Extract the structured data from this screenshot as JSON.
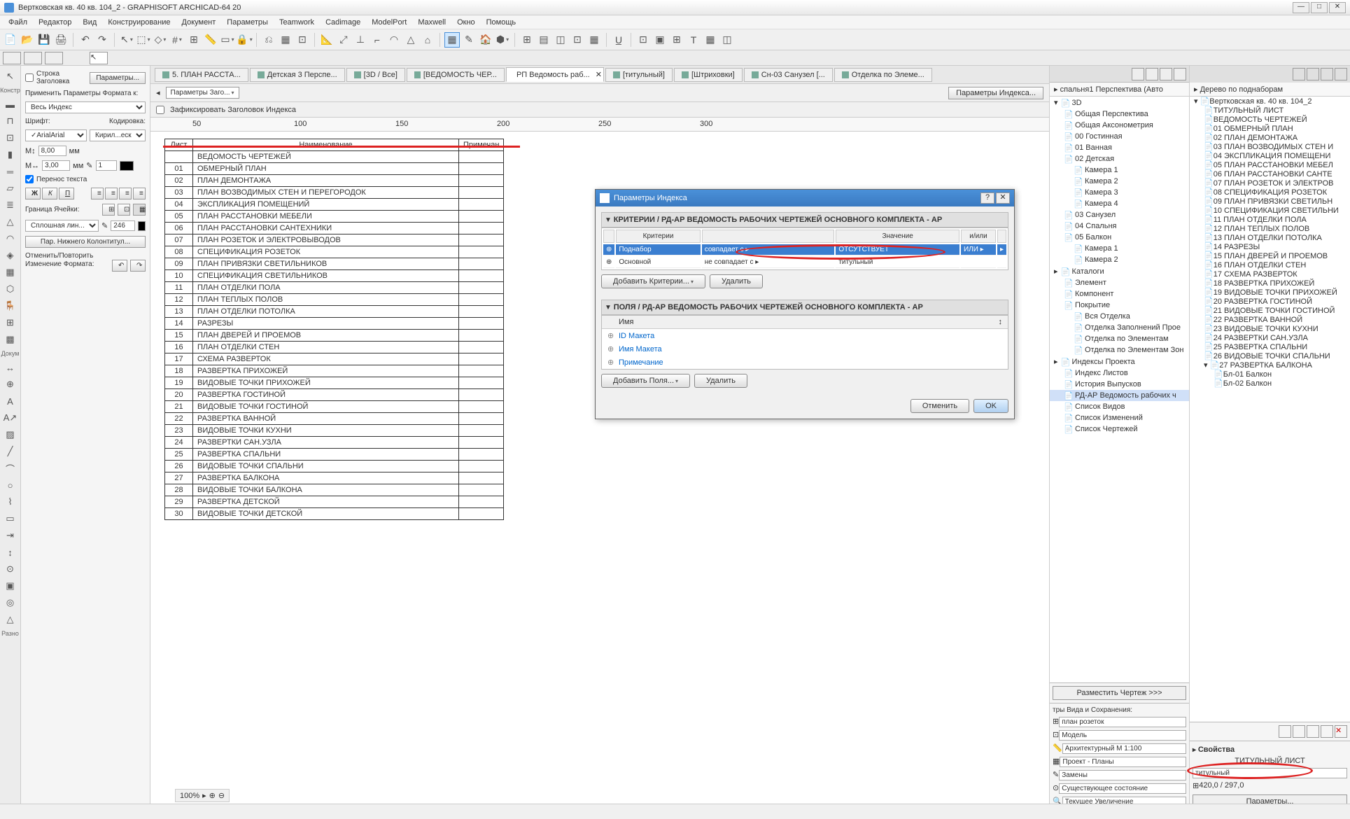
{
  "window": {
    "title": "Вертковская кв. 40 кв. 104_2 - GRAPHISOFT ARCHICAD-64 20"
  },
  "menu": [
    "Файл",
    "Редактор",
    "Вид",
    "Конструирование",
    "Документ",
    "Параметры",
    "Teamwork",
    "Cadimage",
    "ModelPort",
    "Maxwell",
    "Окно",
    "Помощь"
  ],
  "smalltb_arrow": "↖",
  "tabs": [
    {
      "label": "5. ПЛАН РАССТА..."
    },
    {
      "label": "Детская 3 Перспе..."
    },
    {
      "label": "[3D / Все]"
    },
    {
      "label": "[ВЕДОМОСТЬ ЧЕР..."
    },
    {
      "label": "РП Ведомость раб...",
      "active": true,
      "close": true
    },
    {
      "label": "[титульный]"
    },
    {
      "label": "[Штриховки]"
    },
    {
      "label": "Сн-03 Санузел [..."
    },
    {
      "label": "Отделка по Элеме..."
    }
  ],
  "subtool": {
    "header_row": "Строка Заголовка",
    "params_btn": "Параметры...",
    "params_header": "Параметры Заго...",
    "fix_header": "Зафиксировать Заголовок Индекса",
    "index_params": "Параметры Индекса..."
  },
  "format": {
    "apply_label": "Применить Параметры Формата к:",
    "apply_value": "Весь Индекс",
    "font_label": "Шрифт:",
    "encoding_label": "Кодировка:",
    "font_value": "Arial",
    "encoding_value": "Кирил...еский",
    "size1": "8,00",
    "size2": "3,00",
    "unit": "мм",
    "val1": "1",
    "wrap": "Перенос текста",
    "border_label": "Граница Ячейки:",
    "line_style": "Сплошная лин...",
    "line_w": "246",
    "footer_btn": "Пар. Нижнего Колонтитул...",
    "undo_label": "Отменить/Повторить",
    "undo_label2": "Изменение Формата:"
  },
  "table": {
    "headers": [
      "Лист",
      "Наименование",
      "Примечан"
    ],
    "rows": [
      [
        "",
        "ВЕДОМОСТЬ ЧЕРТЕЖЕЙ"
      ],
      [
        "01",
        "ОБМЕРНЫЙ ПЛАН"
      ],
      [
        "02",
        "ПЛАН ДЕМОНТАЖА"
      ],
      [
        "03",
        "ПЛАН ВОЗВОДИМЫХ СТЕН И ПЕРЕГОРОДОК"
      ],
      [
        "04",
        "ЭКСПЛИКАЦИЯ ПОМЕЩЕНИЙ"
      ],
      [
        "05",
        "ПЛАН РАССТАНОВКИ МЕБЕЛИ"
      ],
      [
        "06",
        "ПЛАН РАССТАНОВКИ САНТЕХНИКИ"
      ],
      [
        "07",
        "ПЛАН РОЗЕТОК И ЭЛЕКТРОВЫВОДОВ"
      ],
      [
        "08",
        "СПЕЦИФИКАЦИЯ РОЗЕТОК"
      ],
      [
        "09",
        "ПЛАН ПРИВЯЗКИ СВЕТИЛЬНИКОВ"
      ],
      [
        "10",
        "СПЕЦИФИКАЦИЯ СВЕТИЛЬНИКОВ"
      ],
      [
        "11",
        "ПЛАН ОТДЕЛКИ ПОЛА"
      ],
      [
        "12",
        "ПЛАН ТЕПЛЫХ ПОЛОВ"
      ],
      [
        "13",
        "ПЛАН ОТДЕЛКИ ПОТОЛКА"
      ],
      [
        "14",
        "РАЗРЕЗЫ"
      ],
      [
        "15",
        "ПЛАН ДВЕРЕЙ И ПРОЕМОВ"
      ],
      [
        "16",
        "ПЛАН ОТДЕЛКИ СТЕН"
      ],
      [
        "17",
        "СХЕМА РАЗВЕРТОК"
      ],
      [
        "18",
        "РАЗВЕРТКА ПРИХОЖЕЙ"
      ],
      [
        "19",
        "ВИДОВЫЕ ТОЧКИ ПРИХОЖЕЙ"
      ],
      [
        "20",
        "РАЗВЕРТКА ГОСТИНОЙ"
      ],
      [
        "21",
        "ВИДОВЫЕ ТОЧКИ ГОСТИНОЙ"
      ],
      [
        "22",
        "РАЗВЕРТКА ВАННОЙ"
      ],
      [
        "23",
        "ВИДОВЫЕ ТОЧКИ КУХНИ"
      ],
      [
        "24",
        "РАЗВЕРТКИ САН.УЗЛА"
      ],
      [
        "25",
        "РАЗВЕРТКА СПАЛЬНИ"
      ],
      [
        "26",
        "ВИДОВЫЕ ТОЧКИ СПАЛЬНИ"
      ],
      [
        "27",
        "РАЗВЕРТКА БАЛКОНА"
      ],
      [
        "28",
        "ВИДОВЫЕ ТОЧКИ БАЛКОНА"
      ],
      [
        "29",
        "РАЗВЕРТКА ДЕТСКОЙ"
      ],
      [
        "30",
        "ВИДОВЫЕ ТОЧКИ ДЕТСКОЙ"
      ]
    ]
  },
  "ruler_marks": [
    50,
    100,
    150,
    200,
    250,
    300
  ],
  "dialog": {
    "title": "Параметры Индекса",
    "sec1": "КРИТЕРИИ / РД-АР ВЕДОМОСТЬ РАБОЧИХ ЧЕРТЕЖЕЙ ОСНОВНОГО КОМПЛЕКТА - АР",
    "cols": [
      "Критерии",
      "",
      "Значение",
      "и/или"
    ],
    "rows": [
      {
        "c1": "Поднабор",
        "c2": "совпадает с",
        "c3": "ОТСУТСТВУЕТ",
        "c4": "ИЛИ",
        "sel": true
      },
      {
        "c1": "Основной",
        "c2": "не совпадает с",
        "c3": "титульный",
        "c4": ""
      }
    ],
    "add_crit": "Добавить Критерии...",
    "del": "Удалить",
    "sec2": "ПОЛЯ / РД-АР ВЕДОМОСТЬ РАБОЧИХ ЧЕРТЕЖЕЙ ОСНОВНОГО КОМПЛЕКТА - АР",
    "fld_hdr": "Имя",
    "fields": [
      "ID Макета",
      "Имя Макета",
      "Примечание"
    ],
    "add_fld": "Добавить Поля...",
    "del2": "Удалить",
    "cancel": "Отменить",
    "ok": "OK"
  },
  "nav1": {
    "title": "спальня1 Перспектива (Авто",
    "items": [
      {
        "t": "3D",
        "lvl": 0,
        "exp": true
      },
      {
        "t": "Общая Перспектива",
        "lvl": 1
      },
      {
        "t": "Общая Аксонометрия",
        "lvl": 1
      },
      {
        "t": "00 Гостинная",
        "lvl": 1
      },
      {
        "t": "01 Ванная",
        "lvl": 1
      },
      {
        "t": "02 Детская",
        "lvl": 1
      },
      {
        "t": "Камера 1",
        "lvl": 2
      },
      {
        "t": "Камера 2",
        "lvl": 2
      },
      {
        "t": "Камера 3",
        "lvl": 2
      },
      {
        "t": "Камера 4",
        "lvl": 2
      },
      {
        "t": "03 Санузел",
        "lvl": 1
      },
      {
        "t": "04 Спальня",
        "lvl": 1
      },
      {
        "t": "05 Балкон",
        "lvl": 1
      },
      {
        "t": "Камера 1",
        "lvl": 2
      },
      {
        "t": "Камера 2",
        "lvl": 2
      },
      {
        "t": "Каталоги",
        "lvl": 0
      },
      {
        "t": "Элемент",
        "lvl": 1
      },
      {
        "t": "Компонент",
        "lvl": 1
      },
      {
        "t": "Покрытие",
        "lvl": 1
      },
      {
        "t": "Вся Отделка",
        "lvl": 2
      },
      {
        "t": "Отделка Заполнений Прое",
        "lvl": 2
      },
      {
        "t": "Отделка по Элементам",
        "lvl": 2
      },
      {
        "t": "Отделка по Элементам Зон",
        "lvl": 2
      },
      {
        "t": "Индексы Проекта",
        "lvl": 0
      },
      {
        "t": "Индекс Листов",
        "lvl": 1
      },
      {
        "t": "История Выпусков",
        "lvl": 1
      },
      {
        "t": "РД-АР Ведомость рабочих ч",
        "lvl": 1,
        "sel": true
      },
      {
        "t": "Список Видов",
        "lvl": 1
      },
      {
        "t": "Список Изменений",
        "lvl": 1
      },
      {
        "t": "Список Чертежей",
        "lvl": 1
      }
    ],
    "place": "Разместить Чертеж >>>",
    "props_hdr": "тры Вида и Сохранения:",
    "p1": "план розеток",
    "p2": "Модель",
    "p3": "Архитектурный М 1:100",
    "p4": "Проект - Планы",
    "p5": "Замены",
    "p6": "Существующее состояние",
    "p7": "Текущее Увеличение"
  },
  "nav2": {
    "title": "Дерево по поднаборам",
    "items": [
      {
        "t": "Вертковская кв. 40 кв. 104_2",
        "lvl": 0,
        "exp": true
      },
      {
        "t": "ТИТУЛЬНЫЙ ЛИСТ",
        "lvl": 1
      },
      {
        "t": "ВЕДОМОСТЬ ЧЕРТЕЖЕЙ",
        "lvl": 1
      },
      {
        "t": "01 ОБМЕРНЫЙ ПЛАН",
        "lvl": 1
      },
      {
        "t": "02 ПЛАН ДЕМОНТАЖА",
        "lvl": 1
      },
      {
        "t": "03 ПЛАН ВОЗВОДИМЫХ СТЕН И",
        "lvl": 1
      },
      {
        "t": "04 ЭКСПЛИКАЦИЯ ПОМЕЩЕНИ",
        "lvl": 1
      },
      {
        "t": "05 ПЛАН РАССТАНОВКИ МЕБЕЛ",
        "lvl": 1
      },
      {
        "t": "06 ПЛАН РАССТАНОВКИ САНТЕ",
        "lvl": 1
      },
      {
        "t": "07 ПЛАН РОЗЕТОК И ЭЛЕКТРОВ",
        "lvl": 1
      },
      {
        "t": "08 СПЕЦИФИКАЦИЯ РОЗЕТОК",
        "lvl": 1
      },
      {
        "t": "09 ПЛАН ПРИВЯЗКИ СВЕТИЛЬН",
        "lvl": 1
      },
      {
        "t": "10 СПЕЦИФИКАЦИЯ СВЕТИЛЬНИ",
        "lvl": 1
      },
      {
        "t": "11 ПЛАН ОТДЕЛКИ ПОЛА",
        "lvl": 1
      },
      {
        "t": "12 ПЛАН ТЕПЛЫХ ПОЛОВ",
        "lvl": 1
      },
      {
        "t": "13 ПЛАН ОТДЕЛКИ ПОТОЛКА",
        "lvl": 1
      },
      {
        "t": "14 РАЗРЕЗЫ",
        "lvl": 1
      },
      {
        "t": "15 ПЛАН ДВЕРЕЙ И ПРОЕМОВ",
        "lvl": 1
      },
      {
        "t": "16 ПЛАН ОТДЕЛКИ СТЕН",
        "lvl": 1
      },
      {
        "t": "17 СХЕМА РАЗВЕРТОК",
        "lvl": 1
      },
      {
        "t": "18 РАЗВЕРТКА ПРИХОЖЕЙ",
        "lvl": 1
      },
      {
        "t": "19 ВИДОВЫЕ ТОЧКИ ПРИХОЖЕЙ",
        "lvl": 1
      },
      {
        "t": "20 РАЗВЕРТКА ГОСТИНОЙ",
        "lvl": 1
      },
      {
        "t": "21 ВИДОВЫЕ ТОЧКИ ГОСТИНОЙ",
        "lvl": 1
      },
      {
        "t": "22 РАЗВЕРТКА ВАННОЙ",
        "lvl": 1
      },
      {
        "t": "23 ВИДОВЫЕ ТОЧКИ КУХНИ",
        "lvl": 1
      },
      {
        "t": "24 РАЗВЕРТКИ САН.УЗЛА",
        "lvl": 1
      },
      {
        "t": "25 РАЗВЕРТКА СПАЛЬНИ",
        "lvl": 1
      },
      {
        "t": "26 ВИДОВЫЕ ТОЧКИ СПАЛЬНИ",
        "lvl": 1
      },
      {
        "t": "27 РАЗВЕРТКА БАЛКОНА",
        "lvl": 1,
        "exp": true
      },
      {
        "t": "Бл-01 Балкон",
        "lvl": 2
      },
      {
        "t": "Бл-02 Балкон",
        "lvl": 2
      }
    ],
    "props_title": "Свойства",
    "p_title": "ТИТУЛЬНЫЙ ЛИСТ",
    "p_val": "титульный",
    "p_size": "420,0 / 297,0",
    "params_btn": "Параметры..."
  },
  "zoom": "100%",
  "left_labels": {
    "konstr": "Констр",
    "dokum": "Докум",
    "razno": "Разно"
  }
}
